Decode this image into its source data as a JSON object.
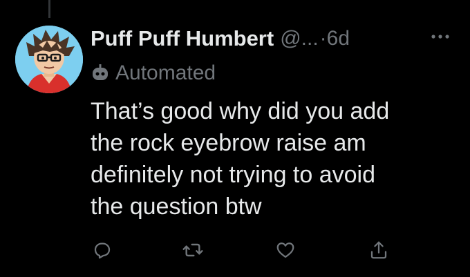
{
  "tweet": {
    "display_name": "Puff Puff Humbert",
    "handle": "@...",
    "separator": "·",
    "timestamp": "6d",
    "automated_label": "Automated",
    "text": "That’s good why did you add\nthe rock eyebrow raise am\ndefinitely not trying to avoid\nthe question btw"
  },
  "icons": {
    "avatar": "cartoon-avatar",
    "more": "more-options-icon",
    "automated": "bot-icon",
    "reply": "reply-icon",
    "retweet": "retweet-icon",
    "like": "like-icon",
    "share": "share-icon"
  },
  "colors": {
    "background": "#000000",
    "primary_text": "#e7e9ea",
    "secondary_text": "#71767b",
    "avatar_bg": "#7dcff0"
  }
}
